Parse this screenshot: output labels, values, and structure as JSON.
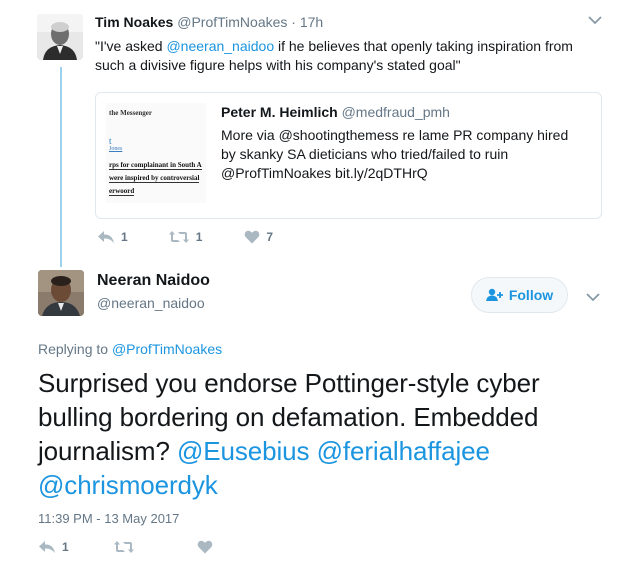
{
  "parent_tweet": {
    "name": "Tim Noakes",
    "handle": "@ProfTimNoakes",
    "separator": "·",
    "time": "17h",
    "text_open": "\"I've asked ",
    "mention": "@neeran_naidoo",
    "text_rest": " if he believes that openly taking inspiration from such a divisive figure helps with his company's stated goal\"",
    "reply_count": "1",
    "retweet_count": "1",
    "like_count": "7"
  },
  "quoted_tweet": {
    "name": "Peter M. Heimlich",
    "handle": "@medfraud_pmh",
    "text": "More via @shootingthemess re lame PR company hired by skanky SA dieticians who tried/failed to ruin @ProfTimNoakes bit.ly/2qDTHrQ",
    "thumb_lines": [
      "the Messenger",
      "t",
      "Jones",
      "rps for complainant in South A",
      "were inspired by controversial",
      "erwoord"
    ]
  },
  "main_tweet": {
    "name": "Neeran Naidoo",
    "handle": "@neeran_naidoo",
    "follow_label": "Follow",
    "replying_prefix": "Replying to ",
    "replying_handle": "@ProfTimNoakes",
    "text_plain": "Surprised you endorse Pottinger-style cyber bulling bordering on defamation. Embedded journalism? ",
    "mention1": "@Eusebius",
    "mention2": "@ferialhaffajee",
    "mention3": "@chrismoerdyk",
    "timestamp": "11:39 PM - 13 May 2017",
    "reply_count": "1"
  },
  "colors": {
    "link": "#1b95e0",
    "muted": "#657786",
    "thread_line": "#9bd2f0",
    "border": "#e1e8ed"
  },
  "icons": [
    "reply-icon",
    "retweet-icon",
    "heart-icon",
    "chevron-down-icon",
    "follow-person-icon"
  ]
}
